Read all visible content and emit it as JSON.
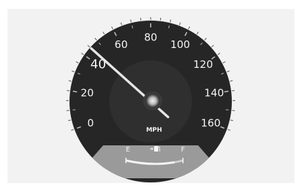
{
  "speedometer": {
    "unit": "MPH",
    "speed_labels": [
      "0",
      "20",
      "40",
      "60",
      "80",
      "100",
      "120",
      "140",
      "160"
    ],
    "highlighted_label": "40",
    "needle_value_mph": 45,
    "colors": {
      "dial_face": "#262626",
      "inner_dial": "#2f2f2f",
      "fuel_panel": "#9a9a9a",
      "needle": "#e6e6e6",
      "labels": "#f4f4f4"
    }
  },
  "fuel_gauge": {
    "empty_label": "E",
    "full_label": "F",
    "icon": "fuel-pump-icon",
    "level": 0.85
  }
}
